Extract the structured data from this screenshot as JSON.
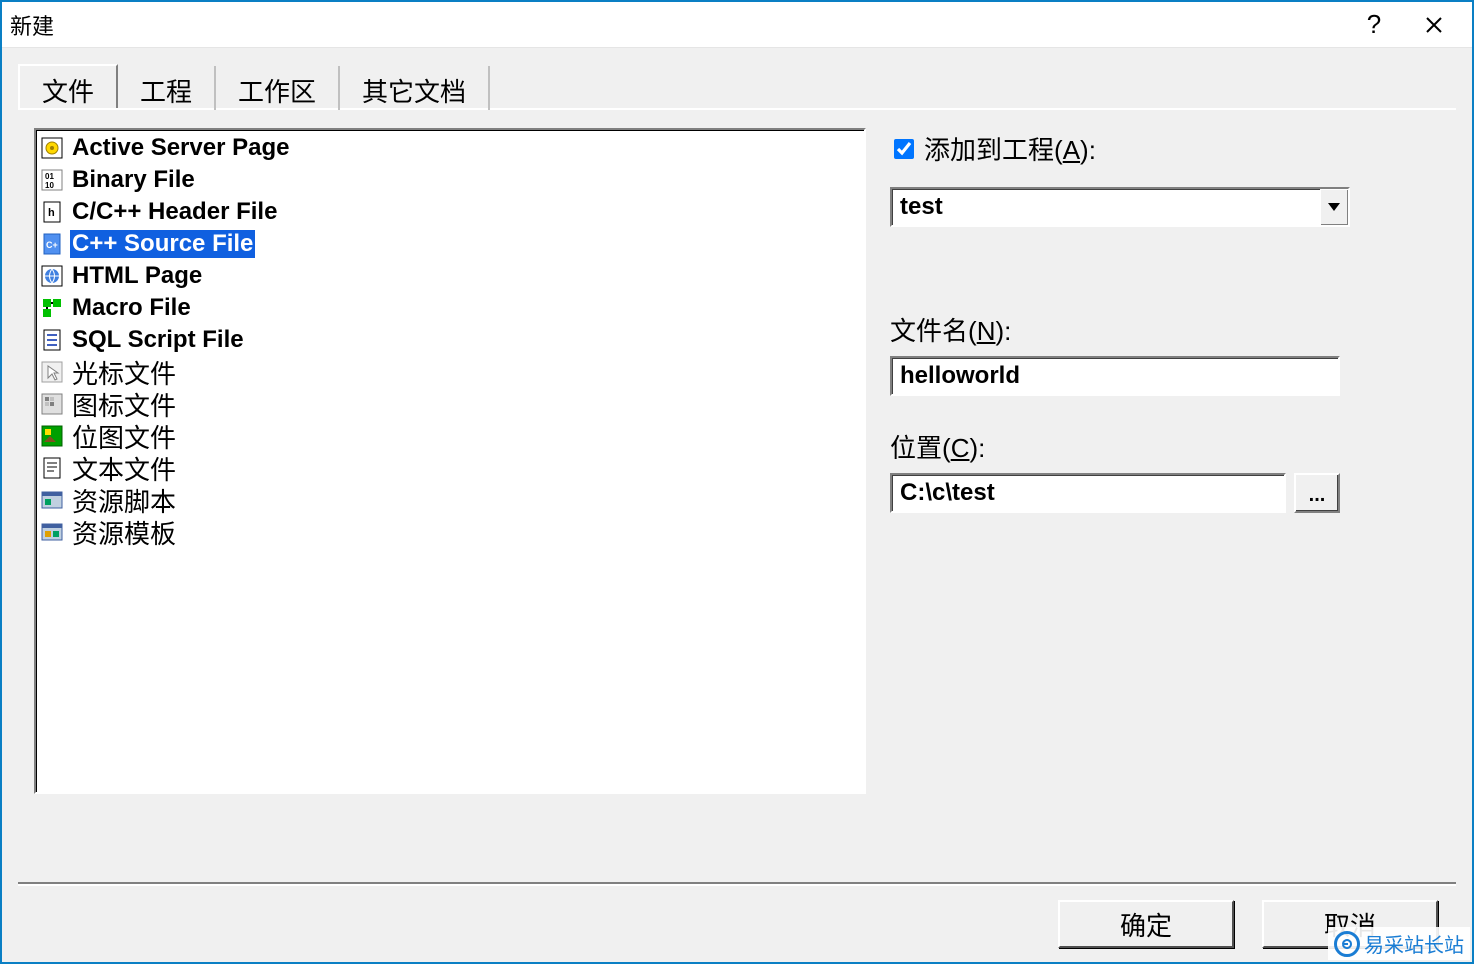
{
  "title": "新建",
  "tabs": [
    "文件",
    "工程",
    "工作区",
    "其它文档"
  ],
  "active_tab": 0,
  "file_types": [
    {
      "label": "Active Server Page",
      "icon": "asp-icon"
    },
    {
      "label": "Binary File",
      "icon": "binary-icon"
    },
    {
      "label": "C/C++ Header File",
      "icon": "header-icon"
    },
    {
      "label": "C++ Source File",
      "icon": "cpp-icon",
      "selected": true
    },
    {
      "label": "HTML Page",
      "icon": "html-icon"
    },
    {
      "label": "Macro File",
      "icon": "macro-icon"
    },
    {
      "label": "SQL Script File",
      "icon": "sql-icon"
    },
    {
      "label": "光标文件",
      "icon": "cursor-icon",
      "cn": true
    },
    {
      "label": "图标文件",
      "icon": "icon-file-icon",
      "cn": true
    },
    {
      "label": "位图文件",
      "icon": "bitmap-icon",
      "cn": true
    },
    {
      "label": "文本文件",
      "icon": "text-icon",
      "cn": true
    },
    {
      "label": "资源脚本",
      "icon": "resource-script-icon",
      "cn": true
    },
    {
      "label": "资源模板",
      "icon": "resource-template-icon",
      "cn": true
    }
  ],
  "right": {
    "add_to_project_label": "添加到工程",
    "add_to_project_hotkey": "A",
    "add_to_project_checked": true,
    "project_value": "test",
    "filename_label": "文件名",
    "filename_hotkey": "N",
    "filename_value": "helloworld",
    "location_label": "位置",
    "location_hotkey": "C",
    "location_value": "C:\\c\\test",
    "browse_label": "..."
  },
  "buttons": {
    "ok": "确定",
    "cancel": "取消"
  },
  "watermark": "易采站长站"
}
